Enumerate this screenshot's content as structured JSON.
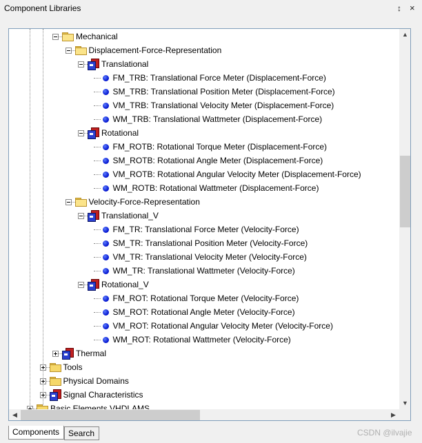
{
  "window": {
    "title": "Component Libraries",
    "pin_glyph": "📌",
    "close_glyph": "×"
  },
  "tree": [
    {
      "label": "Mechanical",
      "depth": 3,
      "kind": "folder-open",
      "expander": "minus"
    },
    {
      "label": "Displacement-Force-Representation",
      "depth": 4,
      "kind": "folder-open",
      "expander": "minus"
    },
    {
      "label": "Translational",
      "depth": 5,
      "kind": "library",
      "expander": "minus"
    },
    {
      "label": "FM_TRB: Translational Force Meter (Displacement-Force)",
      "depth": 6,
      "kind": "component"
    },
    {
      "label": "SM_TRB: Translational Position Meter (Displacement-Force)",
      "depth": 6,
      "kind": "component"
    },
    {
      "label": "VM_TRB: Translational Velocity Meter (Displacement-Force)",
      "depth": 6,
      "kind": "component"
    },
    {
      "label": "WM_TRB: Translational Wattmeter (Displacement-Force)",
      "depth": 6,
      "kind": "component"
    },
    {
      "label": "Rotational",
      "depth": 5,
      "kind": "library",
      "expander": "minus"
    },
    {
      "label": "FM_ROTB: Rotational Torque Meter (Displacement-Force)",
      "depth": 6,
      "kind": "component"
    },
    {
      "label": "SM_ROTB: Rotational Angle Meter (Displacement-Force)",
      "depth": 6,
      "kind": "component"
    },
    {
      "label": "VM_ROTB: Rotational Angular Velocity Meter (Displacement-Force)",
      "depth": 6,
      "kind": "component"
    },
    {
      "label": "WM_ROTB: Rotational Wattmeter (Displacement-Force)",
      "depth": 6,
      "kind": "component"
    },
    {
      "label": "Velocity-Force-Representation",
      "depth": 4,
      "kind": "folder-open",
      "expander": "minus"
    },
    {
      "label": "Translational_V",
      "depth": 5,
      "kind": "library",
      "expander": "minus"
    },
    {
      "label": "FM_TR: Translational Force Meter (Velocity-Force)",
      "depth": 6,
      "kind": "component"
    },
    {
      "label": "SM_TR: Translational Position Meter (Velocity-Force)",
      "depth": 6,
      "kind": "component"
    },
    {
      "label": "VM_TR: Translational Velocity Meter (Velocity-Force)",
      "depth": 6,
      "kind": "component"
    },
    {
      "label": "WM_TR: Translational Wattmeter (Velocity-Force)",
      "depth": 6,
      "kind": "component"
    },
    {
      "label": "Rotational_V",
      "depth": 5,
      "kind": "library",
      "expander": "minus"
    },
    {
      "label": "FM_ROT: Rotational Torque Meter (Velocity-Force)",
      "depth": 6,
      "kind": "component"
    },
    {
      "label": "SM_ROT: Rotational Angle Meter (Velocity-Force)",
      "depth": 6,
      "kind": "component"
    },
    {
      "label": "VM_ROT: Rotational Angular Velocity Meter (Velocity-Force)",
      "depth": 6,
      "kind": "component"
    },
    {
      "label": "WM_ROT: Rotational Wattmeter (Velocity-Force)",
      "depth": 6,
      "kind": "component"
    },
    {
      "label": "Thermal",
      "depth": 3,
      "kind": "library",
      "expander": "plus"
    },
    {
      "label": "Tools",
      "depth": 2,
      "kind": "folder",
      "expander": "plus"
    },
    {
      "label": "Physical Domains",
      "depth": 2,
      "kind": "folder",
      "expander": "plus"
    },
    {
      "label": "Signal Characteristics",
      "depth": 2,
      "kind": "library",
      "expander": "plus"
    },
    {
      "label": "Basic Elements VHDLAMS",
      "depth": 1,
      "kind": "folder",
      "expander": "plus"
    }
  ],
  "tabs": {
    "components": "Components",
    "search": "Search"
  },
  "watermark": "CSDN @ilvajie",
  "colors": {
    "panel_border": "#7f9db9",
    "component_dot": "#0011cc",
    "folder": "#f6d86a",
    "library_red": "#c02020",
    "library_blue": "#2a3fd0"
  }
}
